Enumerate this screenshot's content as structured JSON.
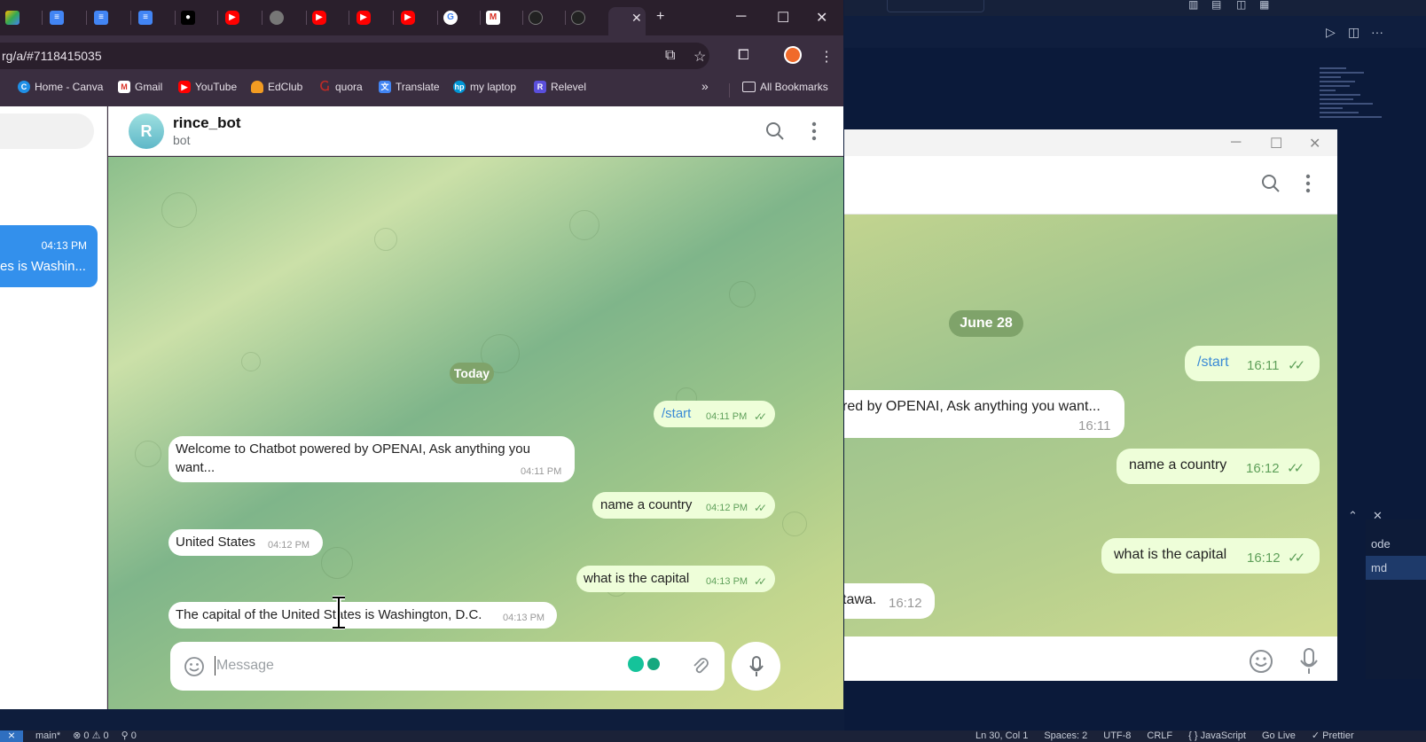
{
  "vscode": {
    "panel_items": [
      "ode",
      "md"
    ],
    "status_left": [
      "main*",
      "⊗ 0 ⚠ 0",
      "⚲ 0"
    ],
    "status_right": [
      "Ln 30, Col 1",
      "Spaces: 2",
      "UTF-8",
      "CRLF",
      "{ } JavaScript",
      "Go Live",
      "✓ Prettier"
    ]
  },
  "chrome": {
    "address": "rg/a/#7118415035",
    "bookmarks": [
      {
        "label": "Home - Canva",
        "icon": "canva-icon",
        "color": "#1f8fe6"
      },
      {
        "label": "Gmail",
        "icon": "gmail-icon",
        "color": "#d93025"
      },
      {
        "label": "YouTube",
        "icon": "youtube-icon",
        "color": "#ff0000"
      },
      {
        "label": "EdClub",
        "icon": "edclub-icon",
        "color": "#f29b22"
      },
      {
        "label": "quora",
        "icon": "quora-icon",
        "color": "#b92b27"
      },
      {
        "label": "Translate",
        "icon": "translate-icon",
        "color": "#4285f4"
      },
      {
        "label": "my laptop",
        "icon": "hp-icon",
        "color": "#0096d6"
      },
      {
        "label": "Relevel",
        "icon": "relevel-icon",
        "color": "#5a4fdc"
      }
    ],
    "all_bookmarks": "All Bookmarks"
  },
  "sidebar": {
    "active_time": "04:13 PM",
    "active_preview": "es is Washin..."
  },
  "chat": {
    "avatar_letter": "R",
    "name": "rince_bot",
    "status": "bot",
    "date_pill": "Today",
    "messages": [
      {
        "dir": "out",
        "text": "/start",
        "time": "04:11 PM",
        "cmd": true
      },
      {
        "dir": "in",
        "text": "Welcome to Chatbot powered by OPENAI, Ask anything you",
        "text2": "want...",
        "time": "04:11 PM"
      },
      {
        "dir": "out",
        "text": "name a country",
        "time": "04:12 PM"
      },
      {
        "dir": "in",
        "text": "United States",
        "time": "04:12 PM"
      },
      {
        "dir": "out",
        "text": "what is the capital",
        "time": "04:13 PM"
      },
      {
        "dir": "in",
        "text": "The capital of the United States is Washington, D.C.",
        "time": "04:13 PM"
      }
    ],
    "composer_placeholder": "Message"
  },
  "tg2": {
    "date_pill": "June 28",
    "messages": [
      {
        "dir": "out",
        "text": "/start",
        "time": "16:11",
        "cmd": true
      },
      {
        "dir": "in",
        "text": "red by OPENAI, Ask anything you want...",
        "time": "16:11"
      },
      {
        "dir": "out",
        "text": "name a country",
        "time": "16:12"
      },
      {
        "dir": "out",
        "text": "what is the capital",
        "time": "16:12"
      },
      {
        "dir": "in",
        "text": "tawa.",
        "time": "16:12"
      }
    ]
  },
  "colors": {
    "telegram_blue": "#3390ec",
    "out_bubble": "#eefed9",
    "chrome_frame": "#3a2e40"
  }
}
